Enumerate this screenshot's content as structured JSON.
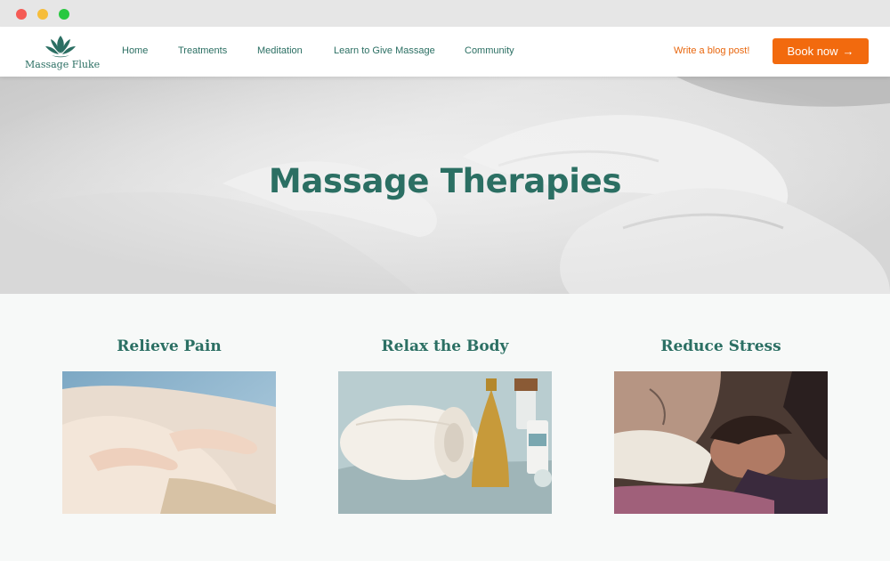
{
  "brand": {
    "name": "Massage Fluke"
  },
  "nav": {
    "items": [
      {
        "label": "Home"
      },
      {
        "label": "Treatments"
      },
      {
        "label": "Meditation"
      },
      {
        "label": "Learn to Give Massage"
      },
      {
        "label": "Community"
      }
    ],
    "blog_link": "Write a blog post!",
    "book_button": "Book now",
    "book_arrow": "→"
  },
  "hero": {
    "title": "Massage Therapies"
  },
  "benefits": [
    {
      "title": "Relieve Pain"
    },
    {
      "title": "Relax the Body"
    },
    {
      "title": "Reduce Stress"
    }
  ],
  "colors": {
    "brand_green": "#2b6f63",
    "accent_orange": "#f26a0e"
  },
  "icons": [
    "lotus-logo-icon",
    "arrow-right-icon"
  ]
}
